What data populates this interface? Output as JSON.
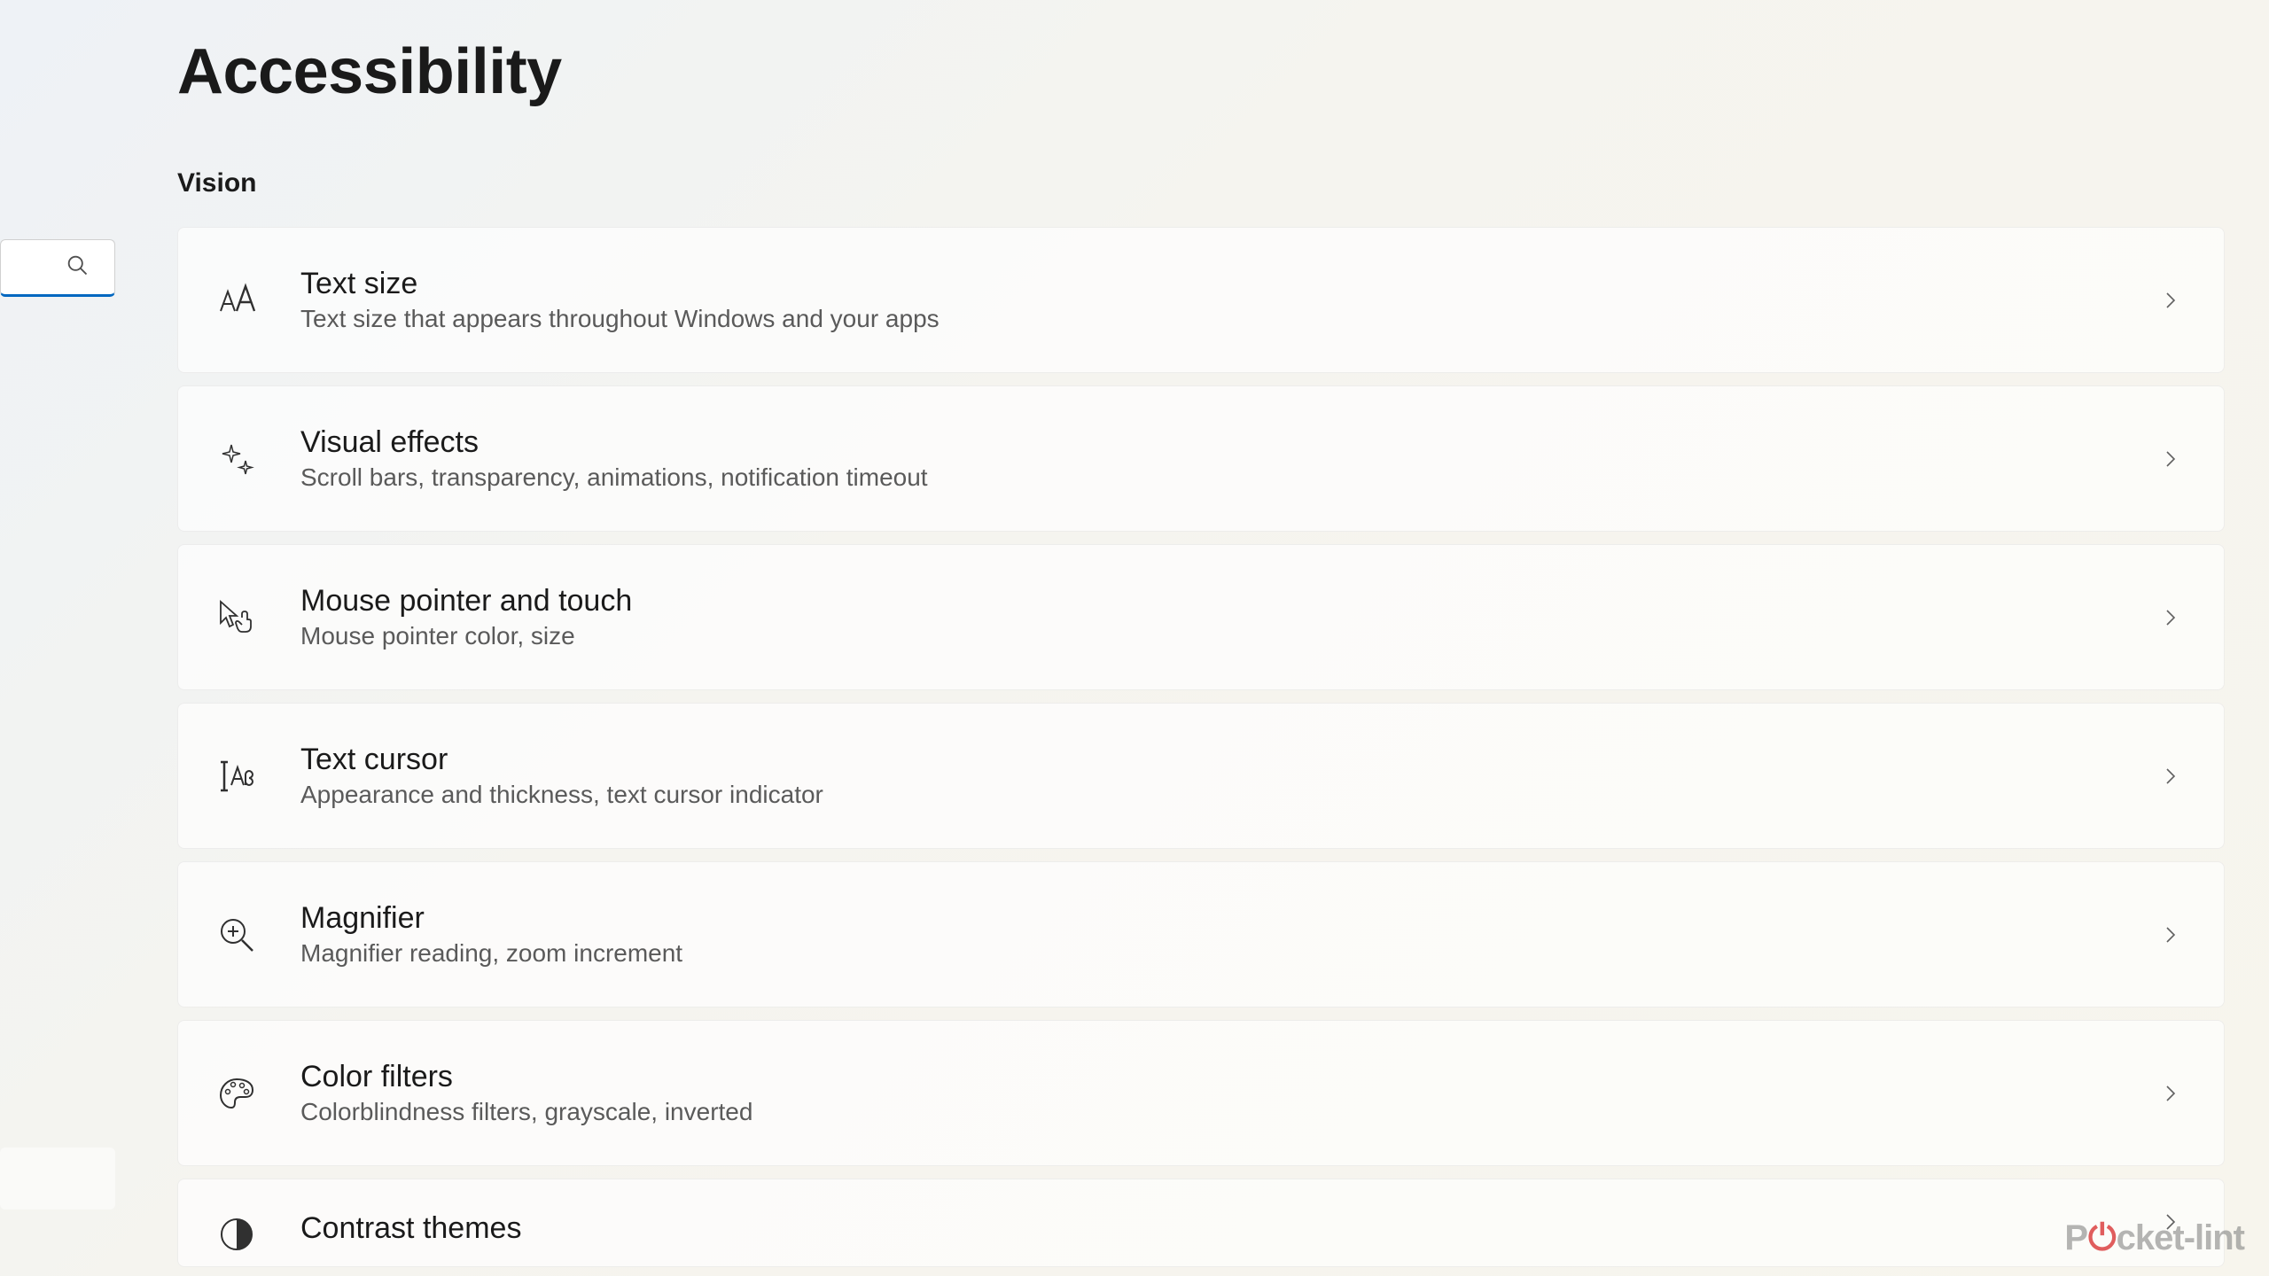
{
  "page": {
    "title": "Accessibility"
  },
  "section": {
    "header": "Vision"
  },
  "items": [
    {
      "icon": "text-size-icon",
      "title": "Text size",
      "desc": "Text size that appears throughout Windows and your apps"
    },
    {
      "icon": "visual-effects-icon",
      "title": "Visual effects",
      "desc": "Scroll bars, transparency, animations, notification timeout"
    },
    {
      "icon": "mouse-pointer-icon",
      "title": "Mouse pointer and touch",
      "desc": "Mouse pointer color, size"
    },
    {
      "icon": "text-cursor-icon",
      "title": "Text cursor",
      "desc": "Appearance and thickness, text cursor indicator"
    },
    {
      "icon": "magnifier-icon",
      "title": "Magnifier",
      "desc": "Magnifier reading, zoom increment"
    },
    {
      "icon": "color-filters-icon",
      "title": "Color filters",
      "desc": "Colorblindness filters, grayscale, inverted"
    },
    {
      "icon": "contrast-themes-icon",
      "title": "Contrast themes",
      "desc": ""
    }
  ],
  "watermark": {
    "pre": "P",
    "post": "cket-lint"
  }
}
